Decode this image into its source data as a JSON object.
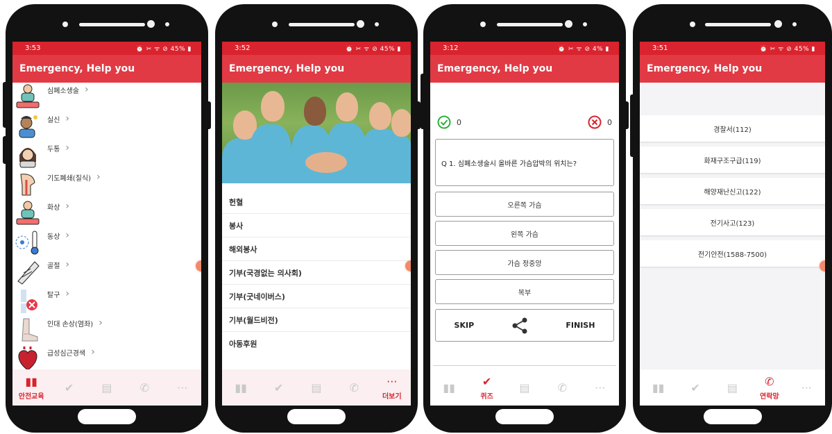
{
  "app_title": "Emergency, Help you",
  "brand_color": "#d9232e",
  "status_icons": "⏰ ✂ ᯤ ⊘",
  "phones": [
    {
      "time": "3:53",
      "battery": "45%"
    },
    {
      "time": "3:52",
      "battery": "45%"
    },
    {
      "time": "3:12",
      "battery": "4%"
    },
    {
      "time": "3:51",
      "battery": "45%"
    }
  ],
  "education_list": [
    {
      "label": "심폐소생술",
      "icon": "cpr-icon"
    },
    {
      "label": "실신",
      "icon": "fainting-icon"
    },
    {
      "label": "두통",
      "icon": "headache-icon"
    },
    {
      "label": "기도폐쇄(질식)",
      "icon": "choking-icon"
    },
    {
      "label": "화상",
      "icon": "burn-icon"
    },
    {
      "label": "동상",
      "icon": "frostbite-icon"
    },
    {
      "label": "골절",
      "icon": "fracture-icon"
    },
    {
      "label": "탈구",
      "icon": "dislocation-icon"
    },
    {
      "label": "인대 손상(염좌)",
      "icon": "sprain-icon"
    },
    {
      "label": "급성심근경색",
      "icon": "heart-attack-icon"
    }
  ],
  "more_menu": [
    "헌혈",
    "봉사",
    "해외봉사",
    "기부(국경없는 의사회)",
    "기부(굿네이버스)",
    "기부(월드비전)",
    "아동후원"
  ],
  "quiz": {
    "correct_count": "0",
    "wrong_count": "0",
    "question": "Q 1. 심폐소생술시 올바른 가슴압박의 위치는?",
    "answers": [
      "오른쪽 가슴",
      "왼쪽 가슴",
      "가슴 정중앙",
      "복부"
    ],
    "skip_label": "SKIP",
    "finish_label": "FINISH"
  },
  "contacts": [
    "경찰서(112)",
    "화재구조구급(119)",
    "해양재난신고(122)",
    "전기사고(123)",
    "전기안전(1588-7500)"
  ],
  "nav": {
    "education": "안전교육",
    "quiz": "퀴즈",
    "contacts": "연락망",
    "more": "더보기"
  }
}
